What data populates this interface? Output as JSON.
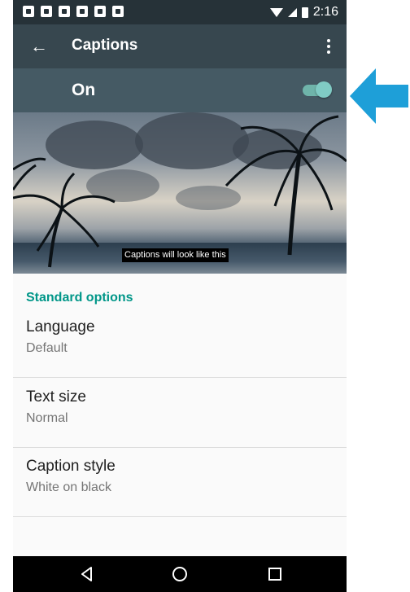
{
  "status_bar": {
    "time": "2:16",
    "notification_icons": [
      "flipboard-icon",
      "flipboard-icon",
      "gmail-icon",
      "gallery-icon",
      "youtube-icon",
      "flipboard-icon"
    ]
  },
  "toolbar": {
    "title": "Captions",
    "back_icon": "arrow-left-icon",
    "more_icon": "more-vert-icon"
  },
  "master_switch": {
    "label": "On",
    "state": true,
    "accent_color": "#80cbc4"
  },
  "preview": {
    "caption_sample": "Captions will look like this"
  },
  "standard_options": {
    "header": "Standard options",
    "items": [
      {
        "title": "Language",
        "summary": "Default"
      },
      {
        "title": "Text size",
        "summary": "Normal"
      },
      {
        "title": "Caption style",
        "summary": "White on black"
      }
    ]
  },
  "nav_bar": {
    "buttons": [
      "back-triangle-icon",
      "home-circle-icon",
      "recents-square-icon"
    ]
  },
  "annotation": {
    "arrow_color": "#1e9fd8",
    "points_to": "master-switch-toggle"
  },
  "colors": {
    "status_bar": "#263238",
    "toolbar": "#37474f",
    "switch_bar": "#455a64",
    "section_header": "#009688"
  }
}
